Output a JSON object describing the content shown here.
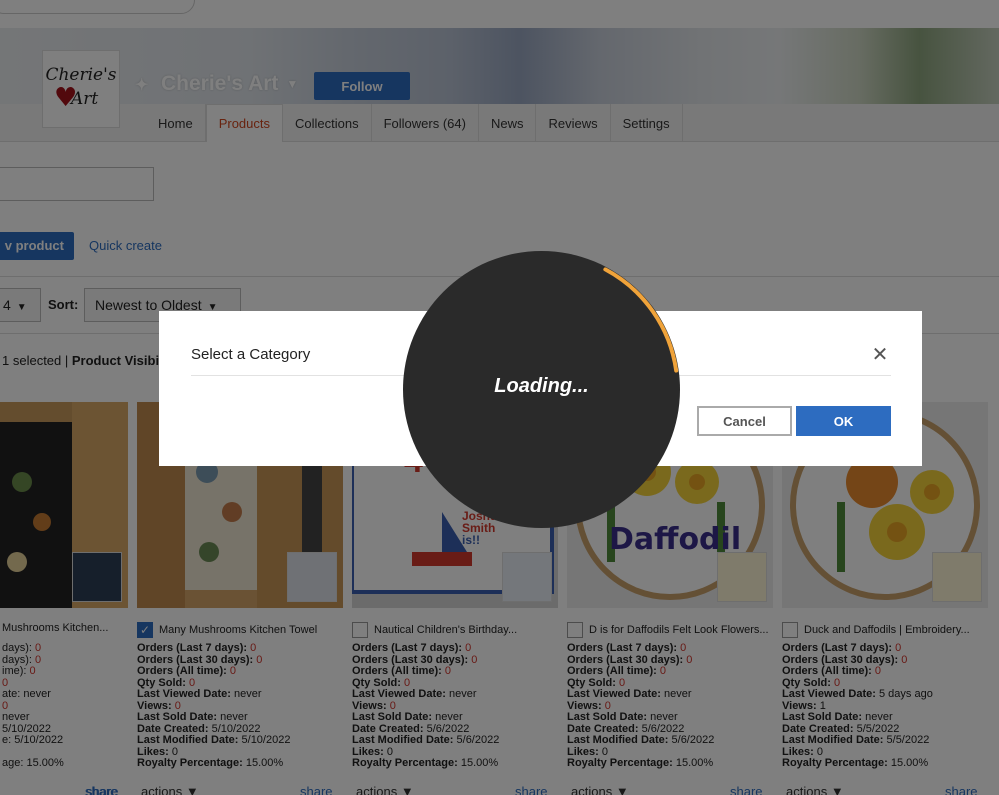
{
  "store": {
    "logo_line1": "Cherie's",
    "logo_line2": "Art",
    "name": "Cherie's Art",
    "follow_label": "Follow"
  },
  "tabs": [
    {
      "label": "Home"
    },
    {
      "label": "Products",
      "active": true
    },
    {
      "label": "Collections"
    },
    {
      "label": "Followers (64)"
    },
    {
      "label": "News"
    },
    {
      "label": "Reviews"
    },
    {
      "label": "Settings"
    }
  ],
  "toolbar": {
    "new_product_label": "v product",
    "quick_create_label": "Quick create",
    "count_value": "4",
    "sort_label": "Sort:",
    "sort_value": "Newest to Oldest",
    "selected_text": "1 selected |",
    "visibility_text": "Product Visibili"
  },
  "products": [
    {
      "title": "Mushrooms Kitchen...",
      "checked": false,
      "lines": [
        {
          "k": "",
          "v": "",
          "tail": " days): ",
          "r": "0"
        },
        {
          "k": "",
          "v": "",
          "tail": " days): ",
          "r": "0"
        },
        {
          "k": "",
          "v": "",
          "tail": "ime): ",
          "r": "0"
        },
        {
          "k": "",
          "v": "",
          "tail": "",
          "r": "0"
        },
        {
          "k": "",
          "v": "",
          "tail": "ate: never",
          "r": ""
        },
        {
          "k": "",
          "v": "",
          "tail": "",
          "r": "0"
        },
        {
          "k": "",
          "v": "",
          "tail": " never",
          "r": ""
        },
        {
          "k": "",
          "v": "",
          "tail": "5/10/2022",
          "r": ""
        },
        {
          "k": "",
          "v": "",
          "tail": "e: 5/10/2022",
          "r": ""
        },
        {
          "k": "",
          "v": "",
          "tail": "",
          "r": ""
        },
        {
          "k": "",
          "v": "",
          "tail": "age: 15.00%",
          "r": ""
        }
      ],
      "share": "share",
      "actions": ""
    },
    {
      "title": "Many Mushrooms Kitchen Towel",
      "checked": true,
      "lines": [
        {
          "k": "Orders (Last 7 days): ",
          "r": "0"
        },
        {
          "k": "Orders (Last 30 days): ",
          "r": "0"
        },
        {
          "k": "Orders (All time): ",
          "r": "0"
        },
        {
          "k": "Qty Sold: ",
          "r": "0"
        },
        {
          "k": "Last Viewed Date: ",
          "v": "never"
        },
        {
          "k": "Views: ",
          "r": "0"
        },
        {
          "k": "Last Sold Date: ",
          "v": "never"
        },
        {
          "k": "Date Created: ",
          "v": "5/10/2022"
        },
        {
          "k": "Last Modified Date: ",
          "v": "5/10/2022"
        },
        {
          "k": "Likes: ",
          "v": "0"
        },
        {
          "k": "Royalty Percentage: ",
          "v": "15.00%"
        }
      ],
      "share": "share",
      "actions": "actions"
    },
    {
      "title": "Nautical Children's Birthday...",
      "checked": false,
      "lines": [
        {
          "k": "Orders (Last 7 days): ",
          "r": "0"
        },
        {
          "k": "Orders (Last 30 days): ",
          "r": "0"
        },
        {
          "k": "Orders (All time): ",
          "r": "0"
        },
        {
          "k": "Qty Sold: ",
          "r": "0"
        },
        {
          "k": "Last Viewed Date: ",
          "v": "never"
        },
        {
          "k": "Views: ",
          "r": "0"
        },
        {
          "k": "Last Sold Date: ",
          "v": "never"
        },
        {
          "k": "Date Created: ",
          "v": "5/6/2022"
        },
        {
          "k": "Last Modified Date: ",
          "v": "5/6/2022"
        },
        {
          "k": "Likes: ",
          "v": "0"
        },
        {
          "k": "Royalty Percentage: ",
          "v": "15.00%"
        }
      ],
      "share": "share",
      "actions": "actions"
    },
    {
      "title": "D is for Daffodils Felt Look Flowers...",
      "checked": false,
      "lines": [
        {
          "k": "Orders (Last 7 days): ",
          "r": "0"
        },
        {
          "k": "Orders (Last 30 days): ",
          "r": "0"
        },
        {
          "k": "Orders (All time): ",
          "r": "0"
        },
        {
          "k": "Qty Sold: ",
          "r": "0"
        },
        {
          "k": "Last Viewed Date: ",
          "v": "never"
        },
        {
          "k": "Views: ",
          "r": "0"
        },
        {
          "k": "Last Sold Date: ",
          "v": "never"
        },
        {
          "k": "Date Created: ",
          "v": "5/6/2022"
        },
        {
          "k": "Last Modified Date: ",
          "v": "5/6/2022"
        },
        {
          "k": "Likes: ",
          "v": "0"
        },
        {
          "k": "Royalty Percentage: ",
          "v": "15.00%"
        }
      ],
      "share": "share",
      "actions": "actions"
    },
    {
      "title": "Duck and Daffodils | Embroidery...",
      "checked": false,
      "lines": [
        {
          "k": "Orders (Last 7 days): ",
          "r": "0"
        },
        {
          "k": "Orders (Last 30 days): ",
          "r": "0"
        },
        {
          "k": "Orders (All time): ",
          "r": "0"
        },
        {
          "k": "Qty Sold: ",
          "r": "0"
        },
        {
          "k": "Last Viewed Date: ",
          "v": "5 days ago"
        },
        {
          "k": "Views: ",
          "v": "1"
        },
        {
          "k": "Last Sold Date: ",
          "v": "never"
        },
        {
          "k": "Date Created: ",
          "v": "5/5/2022"
        },
        {
          "k": "Last Modified Date: ",
          "v": "5/5/2022"
        },
        {
          "k": "Likes: ",
          "v": "0"
        },
        {
          "k": "Royalty Percentage: ",
          "v": "15.00%"
        }
      ],
      "share": "share",
      "actions": "actions"
    }
  ],
  "thumb_text": {
    "joshua": "Joshua",
    "smith": "Smith",
    "is": "is!!",
    "join": "JOIN US FOR SOME FUN",
    "daffodil": "Daffodil"
  },
  "modal": {
    "title": "Select a Category",
    "cancel_label": "Cancel",
    "ok_label": "OK"
  },
  "spinner": {
    "label": "Loading...",
    "accent": "#f0a33a"
  }
}
